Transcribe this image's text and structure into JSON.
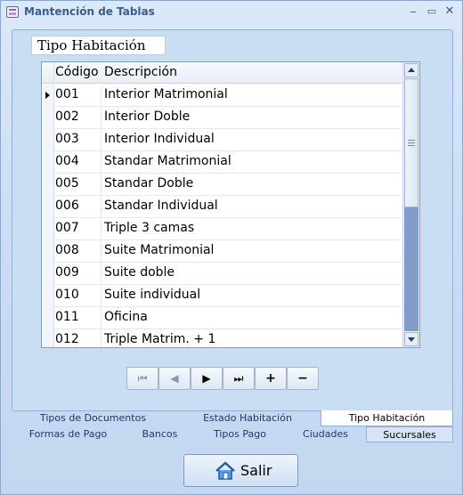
{
  "window": {
    "title": "Mantención de Tablas",
    "minimize": "‒",
    "maximize": "▭",
    "close": "✕"
  },
  "panel": {
    "caption": "Tipo Habitación"
  },
  "grid": {
    "headers": {
      "code": "Código",
      "desc": "Descripción"
    },
    "rows": [
      {
        "code": "001",
        "desc": "Interior Matrimonial"
      },
      {
        "code": "002",
        "desc": "Interior Doble"
      },
      {
        "code": "003",
        "desc": "Interior Individual"
      },
      {
        "code": "004",
        "desc": "Standar Matrimonial"
      },
      {
        "code": "005",
        "desc": "Standar Doble"
      },
      {
        "code": "006",
        "desc": "Standar Individual"
      },
      {
        "code": "007",
        "desc": "Triple 3 camas"
      },
      {
        "code": "008",
        "desc": "Suite Matrimonial"
      },
      {
        "code": "009",
        "desc": "Suite doble"
      },
      {
        "code": "010",
        "desc": "Suite individual"
      },
      {
        "code": "011",
        "desc": "Oficina"
      },
      {
        "code": "012",
        "desc": "Triple Matrim. + 1"
      }
    ]
  },
  "navigator": {
    "first": "⏮",
    "prev": "◀",
    "next": "▶",
    "last": "⏭",
    "add": "+",
    "remove": "−"
  },
  "tabs": {
    "row1": [
      "Tipos de Documentos",
      "Estado Habitación",
      "Tipo Habitación"
    ],
    "row2": [
      "Formas de Pago",
      "Bancos",
      "Tipos Pago",
      "Ciudades",
      "Sucursales"
    ]
  },
  "exit_button": {
    "label": "Salir"
  }
}
